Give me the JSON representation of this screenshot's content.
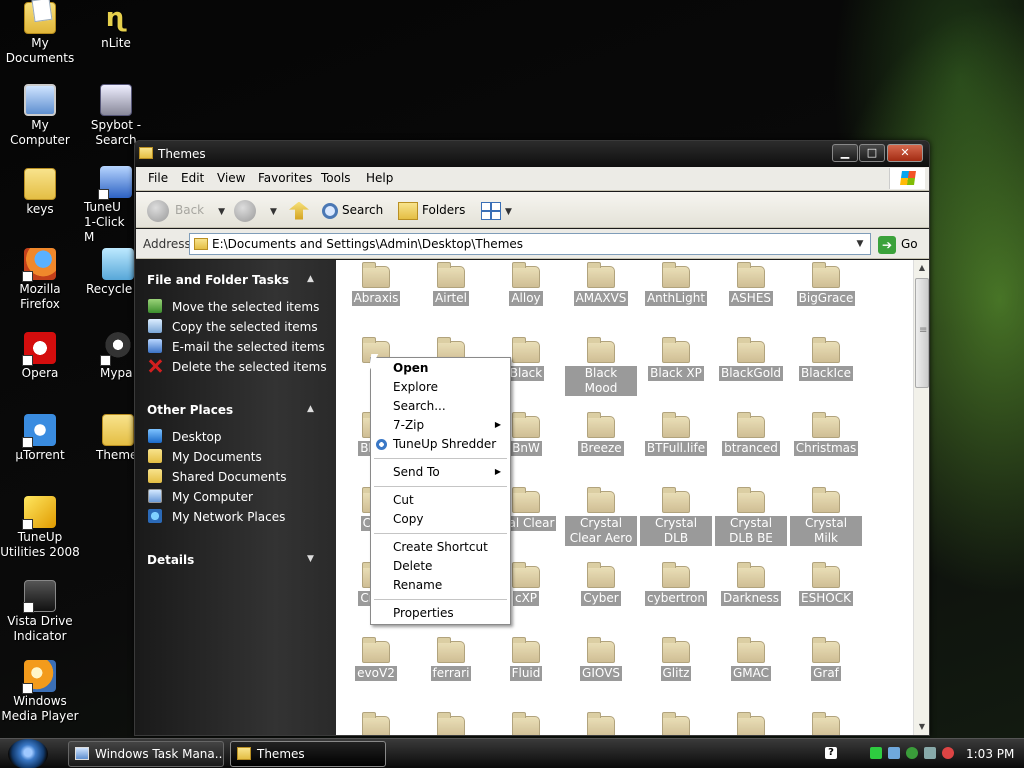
{
  "desktop": {
    "icons": [
      {
        "label": "My Documents"
      },
      {
        "label": "My Computer"
      },
      {
        "label": "keys"
      },
      {
        "label": "Mozilla Firefox"
      },
      {
        "label": "Opera"
      },
      {
        "label": "µTorrent"
      },
      {
        "label": "TuneUp Utilities 2008"
      },
      {
        "label": "Vista Drive Indicator"
      },
      {
        "label": "Windows Media Player"
      },
      {
        "label": "nLite"
      },
      {
        "label": "Spybot - Search"
      },
      {
        "label": "TuneU 1-Click M"
      },
      {
        "label": "Recycle I"
      },
      {
        "label": "Mypa"
      },
      {
        "label": "Theme"
      }
    ]
  },
  "window": {
    "title": "Themes",
    "minimize": "▁",
    "maximize": "□",
    "close": "✕"
  },
  "menubar": {
    "items": [
      "File",
      "Edit",
      "View",
      "Favorites",
      "Tools",
      "Help"
    ]
  },
  "toolbar": {
    "back": "Back",
    "search": "Search",
    "folders": "Folders"
  },
  "address": {
    "label": "Address",
    "value": "E:\\Documents and Settings\\Admin\\Desktop\\Themes",
    "go": "Go"
  },
  "taskpane": {
    "file_tasks_title": "File and Folder Tasks",
    "file_tasks": [
      "Move the selected items",
      "Copy the selected items",
      "E-mail the selected items",
      "Delete the selected items"
    ],
    "other_places_title": "Other Places",
    "other_places": [
      "Desktop",
      "My Documents",
      "Shared Documents",
      "My Computer",
      "My Network Places"
    ],
    "details_title": "Details"
  },
  "files": {
    "rows": [
      [
        "Abraxis",
        "Airtel",
        "Alloy",
        "AMAXVS",
        "AnthLight",
        "ASHES",
        "BigGrace"
      ],
      [
        "B",
        "",
        "Black",
        "Black Mood",
        "Black XP",
        "BlackGold",
        "BlackIce"
      ],
      [
        "BLAC",
        "",
        "BnW",
        "Breeze",
        "BTFull.life",
        "btranced",
        "Christmas"
      ],
      [
        "Clou",
        "",
        "stal Clear",
        "Crystal Clear Aero",
        "Crystal DLB",
        "Crystal DLB BE",
        "Crystal Milk"
      ],
      [
        "Cryst",
        "",
        "cXP",
        "Cyber",
        "cybertron",
        "Darkness",
        "ESHOCK"
      ],
      [
        "evoV2",
        "ferrari",
        "Fluid",
        "GIOVS",
        "Glitz",
        "GMAC",
        "Graf"
      ],
      [
        "",
        "",
        "",
        "",
        "",
        "",
        ""
      ]
    ]
  },
  "context_menu": {
    "open": "Open",
    "explore": "Explore",
    "search": "Search...",
    "zip": "7-Zip",
    "shredder": "TuneUp Shredder",
    "send_to": "Send To",
    "cut": "Cut",
    "copy": "Copy",
    "create_shortcut": "Create Shortcut",
    "delete": "Delete",
    "rename": "Rename",
    "properties": "Properties"
  },
  "taskbar": {
    "buttons": [
      "Windows Task Mana...",
      "Themes"
    ],
    "help": "?",
    "clock": "1:03 PM"
  }
}
